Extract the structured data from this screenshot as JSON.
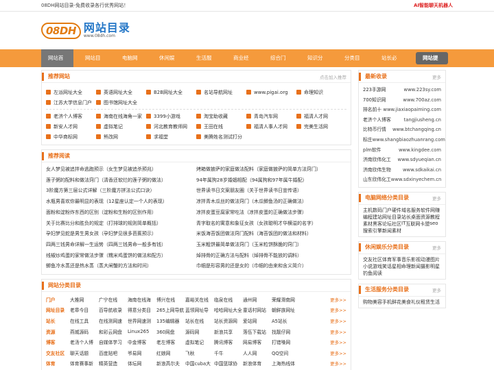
{
  "topbar": {
    "left": "08DH网站目录-免费收录各行优秀网站！",
    "right": "AI智能聊天机器人"
  },
  "logo": {
    "badge": "08DH",
    "title": "网站目录",
    "url": "www.08dh.com"
  },
  "nav": [
    "网站首页",
    "网站目录",
    "电脑网络",
    "休闲娱乐",
    "生活服务",
    "商业经济",
    "综合门户",
    "知识分享",
    "分类目录",
    "站长必看"
  ],
  "nav_submit": "网站提交",
  "recommend": {
    "title": "推荐网站",
    "more": "点击加入推荐",
    "row1": [
      "左派网址大全",
      "英语网址大全",
      "B2B网址大全",
      "名站导航网址",
      "www.pigai.org",
      "命理知识",
      "江苏大学信息门户",
      "图书馆网址大全"
    ],
    "row2": [
      "老济个人博客",
      "海南在线海角一家",
      "3399小游戏",
      "淘宝助收藏",
      "青岛汽车网",
      "福清人才网",
      "新安人才网",
      "虚拟笔记",
      "河北教育教师网",
      "王田在线",
      "福清人事人才网",
      "完美生活网",
      "中华商标网",
      "熊改网",
      "求福堂",
      "美腾姓名测试打分"
    ]
  },
  "reading": {
    "title": "推荐阅读",
    "left": [
      "女人梦见被追拌命逃跑预示（女生梦见被追杀预兆）",
      "莲子粥的配料和做法窍门（清香还软烂的莲子粥的做法）",
      "3阶魔方第三层公式详解（三阶魔方拼法公式口诀）",
      "水瓶男喜欢你最明显的表现（12星座认定一个人的表现）",
      "面粉和淀粉炸东西的区别（淀粉和生粉的区别作用）",
      "关于比赛比分和胜负的规定（打排球的规则简单概括）",
      "孕妇梦见蛇是男生男女孩（孕妇梦见很多芭蕉预示）",
      "四两三钱男命详解一生运势（四两三钱男命一般多有钱）",
      "线椒炒鸡蛋的家常做法步骤（糯米鸡蛋饼的做法和配方）",
      "鲫鱼冷水蒸还是热水蒸（蒸大闸蟹的方法和时间）"
    ],
    "right": [
      "烤箱做披萨的家庭做法配料（家庭做披萨的简单方法窍门）",
      "94年属狗28岁婚姻相配（94属狗和97年属牛婚配）",
      "世界读书日文案朋友圈（关于世界读书日宣传语）",
      "凉拌青木瓜丝的做法窍门（木瓜鲫鱼汤的正确做法）",
      "凉拌皮蛋豆腐家常吃法（凉拌皮蛋的正确做法步骤）",
      "青字取名的寓意和象征女孩（女孩聪明才华横溢的名字）",
      "米饭海苔饭团做法窍门配料（海苔饭团的做法和材料）",
      "玉米粗饼最简单做法窍门（玉米粒饼酥脆的窍门）",
      "焯排骨的正确方法与配料（焯排骨不能放的调料）",
      "巾帼是形容男的还是女的（巾帼的由来和含义简介）"
    ]
  },
  "category": {
    "title": "网站分类目录",
    "more": "更多>>",
    "rows": [
      {
        "name": "门户",
        "items": [
          "大推网",
          "广宁在线",
          "海南在线海",
          "博兴在线",
          "嘉峪关在线",
          "临泉在线",
          "通州网",
          "荣耀滑南网"
        ]
      },
      {
        "name": "网址目录",
        "items": [
          "老章今目",
          "百导航收录",
          "得意分类目",
          "265上网导航",
          "蓝领网址导",
          "哈哈网址大全",
          "童话村网站",
          "朝鲜族网址"
        ]
      },
      {
        "name": "站长",
        "items": [
          "在线工具",
          "在线测网速",
          "世界网速测",
          "135编辑器",
          "站长在线",
          "站长资源网",
          "爱站网",
          "A5站长"
        ]
      },
      {
        "name": "资源",
        "items": [
          "燕城源码",
          "和彩云网盘",
          "Linux265",
          "360网盘",
          "源码网",
          "新浪共享",
          "落伍下载站",
          "找靓仔网"
        ]
      },
      {
        "name": "博客",
        "items": [
          "老汤个人博",
          "自媒体学习",
          "中金博客",
          "老左博客",
          "虚拟笔记",
          "腾讯博客",
          "网易博客",
          "打错嗓网"
        ]
      },
      {
        "name": "交友社区",
        "items": [
          "聊天话题",
          "百度贴吧",
          "爷易网",
          "红娘网",
          "飞秋",
          "千牛",
          "人人网",
          "QQ空间"
        ]
      },
      {
        "name": "体育",
        "items": [
          "体育赛事新",
          "精英营造",
          "体坛网",
          "新浪高尔夫",
          "中国cuba大",
          "中国篮球协",
          "新浪体育",
          "上海热线体"
        ]
      }
    ]
  },
  "latest": {
    "title": "最新收录",
    "more": "更多",
    "items": [
      {
        "n": "223手游网",
        "u": "www.223sy.com"
      },
      {
        "n": "700知识网",
        "u": "www.700az.com"
      },
      {
        "n": "排名前十",
        "u": "www.jiaxiaopaiming.com"
      },
      {
        "n": "老济个人博客",
        "u": "tangjiusheng.cn"
      },
      {
        "n": "比特币行情",
        "u": "www.btchangqing.cn"
      },
      {
        "n": "标庄",
        "u": "www.shangbiaozhuanrang.com"
      },
      {
        "n": "plm软件",
        "u": "www.kingdee.com"
      },
      {
        "n": "济南欣伟化工",
        "u": "www.sdyueqian.cn"
      },
      {
        "n": "济南欣伟生物",
        "u": "www.sdkaikai.cn"
      },
      {
        "n": "山东欣伟化工",
        "u": "www.sdxinyechem.cn"
      }
    ]
  },
  "computer": {
    "title": "电脑网络分类目录",
    "more": "更多",
    "items": [
      "主机",
      "数码",
      "门户",
      "硬件",
      "域名服务",
      "软件",
      "网赚",
      "编程",
      "建站",
      "网址目录",
      "站长",
      "桌面",
      "资源",
      "教程",
      "素材",
      "黑客",
      "论坛",
      "社区",
      "IT",
      "互联网",
      "卡盟",
      "seo",
      "搜索引擎",
      "新闻",
      "素材"
    ]
  },
  "leisure": {
    "title": "休闲娱乐分类目录",
    "more": "更多",
    "items": [
      "交友社区",
      "体育",
      "军事",
      "音乐",
      "影视",
      "动漫",
      "图片",
      "小说",
      "游戏",
      "笑话",
      "星相命理",
      "新闻",
      "摄影",
      "明星",
      "钓鱼",
      "阅读"
    ]
  },
  "life": {
    "title": "生活服务分类目录",
    "more": "更多",
    "items": [
      "购物",
      "美容",
      "手机",
      "鲜花",
      "美食",
      "礼仪",
      "租赁",
      "生活"
    ]
  }
}
